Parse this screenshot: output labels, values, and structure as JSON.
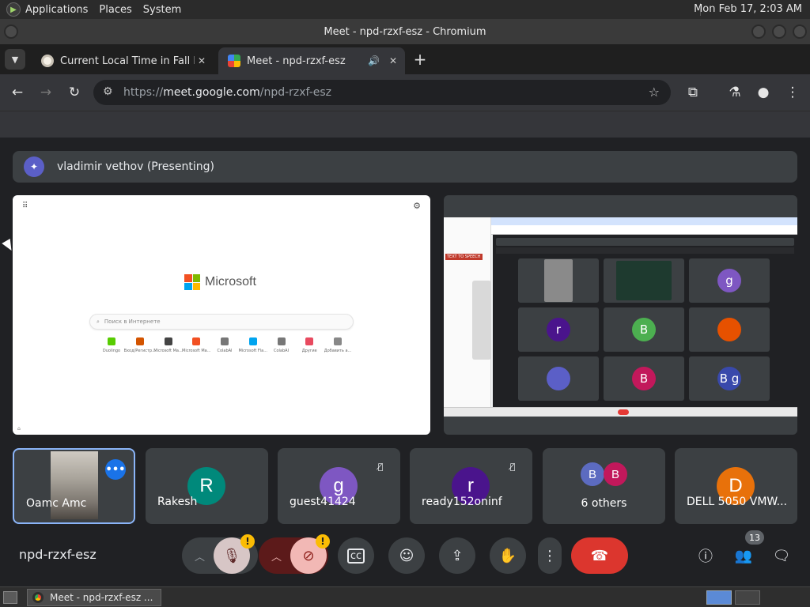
{
  "system": {
    "menus": [
      "Applications",
      "Places",
      "System"
    ],
    "clock": "Mon Feb 17,  2:03 AM"
  },
  "window": {
    "title": "Meet - npd-rzxf-esz - Chromium"
  },
  "tabs": [
    {
      "title": "Current Local Time in Fall Riv",
      "active": false
    },
    {
      "title": "Meet - npd-rzxf-esz",
      "active": true
    }
  ],
  "toolbar": {
    "url_scheme": "https://",
    "url_host": "meet.google.com",
    "url_path": "/npd-rzxf-esz"
  },
  "meet": {
    "presenter_label": "vladimir vethov (Presenting)",
    "shared_left": {
      "brand": "Microsoft",
      "search_placeholder": "Поиск в Интернете",
      "tiles": [
        {
          "label": "Duolingo",
          "color": "#58cc02"
        },
        {
          "label": "Вход/Регистр...",
          "color": "#d35400"
        },
        {
          "label": "Microsoft Ma...",
          "color": "#444444"
        },
        {
          "label": "Microsoft Ma...",
          "color": "#f25022"
        },
        {
          "label": "ColabAI",
          "color": "#777777"
        },
        {
          "label": "Microsoft Fla...",
          "color": "#00a4ef"
        },
        {
          "label": "ColabAI",
          "color": "#777777"
        },
        {
          "label": "Другие",
          "color": "#e84a5f"
        },
        {
          "label": "Добавить а...",
          "color": "#888888"
        }
      ]
    },
    "shared_right": {
      "tts_label": "TEXT TO SPEECH",
      "mini_tiles": [
        {
          "letter": "",
          "color": "#8a8a8a"
        },
        {
          "letter": "",
          "color": "#1e3a2f"
        },
        {
          "letter": "g",
          "color": "#7e57c2"
        },
        {
          "letter": "r",
          "color": "#4a148c"
        },
        {
          "letter": "B",
          "color": "#4caf50"
        },
        {
          "letter": "",
          "color": "#e65100"
        },
        {
          "letter": "",
          "color": "#5b5fc7"
        },
        {
          "letter": "B",
          "color": "#c2185b"
        },
        {
          "letter": "B g",
          "color": "#3949ab"
        }
      ]
    },
    "participants": [
      {
        "name": "Oamc Amc",
        "self": true
      },
      {
        "name": "Rakesh",
        "letter": "R",
        "color": "#00897b",
        "muted": false
      },
      {
        "name": "guest41424",
        "letter": "g",
        "color": "#7e57c2",
        "muted": true
      },
      {
        "name": "ready152oninf",
        "letter": "r",
        "color": "#4a148c",
        "muted": true
      },
      {
        "name": "6 others",
        "others": [
          {
            "letter": "B",
            "color": "#5c6bc0"
          },
          {
            "letter": "B",
            "color": "#c2185b"
          }
        ]
      },
      {
        "name": "DELL 5050 VMW...",
        "letter": "D",
        "color": "#e8710a",
        "muted": false
      }
    ],
    "meeting_code": "npd-rzxf-esz",
    "people_count": "13",
    "warning_symbol": "!"
  },
  "taskbar": {
    "item": "Meet - npd-rzxf-esz ..."
  }
}
